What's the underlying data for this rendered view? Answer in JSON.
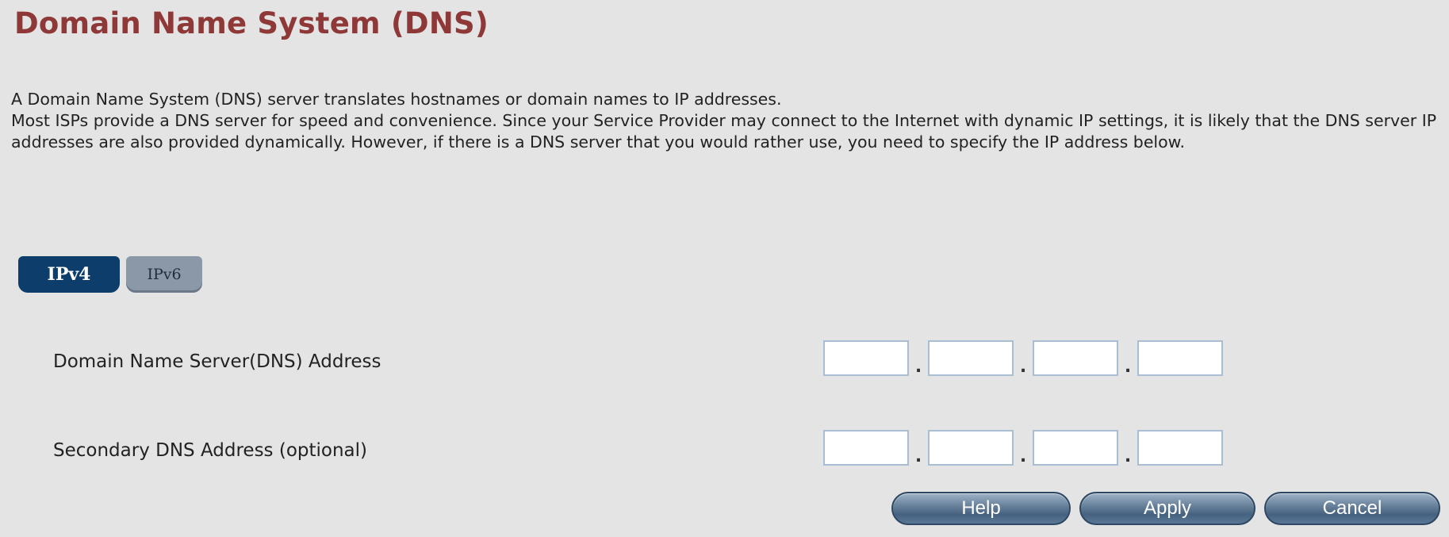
{
  "page": {
    "title": "Domain Name System (DNS)",
    "description": [
      "A Domain Name System (DNS) server translates hostnames or domain names to IP addresses.",
      "Most ISPs provide a DNS server for speed and convenience. Since your Service Provider may connect to the Internet with dynamic IP settings, it is likely that the DNS server IP addresses are also provided dynamically. However, if there is a DNS server that you would rather use, you need to specify the IP address below."
    ]
  },
  "tabs": {
    "ipv4": "IPv4",
    "ipv6": "IPv6",
    "active": "IPv4"
  },
  "fields": {
    "primary_dns": {
      "label": "Domain Name Server(DNS) Address",
      "octets": [
        "",
        "",
        "",
        ""
      ]
    },
    "secondary_dns": {
      "label": "Secondary DNS Address (optional)",
      "octets": [
        "",
        "",
        "",
        ""
      ]
    },
    "separator": "."
  },
  "buttons": {
    "help": "Help",
    "apply": "Apply",
    "cancel": "Cancel"
  },
  "colors": {
    "background": "#e4e4e4",
    "title": "#8e3838",
    "tab_active": "#0d3d6a",
    "tab_inactive": "#8a98a8",
    "button": "#45627f"
  }
}
